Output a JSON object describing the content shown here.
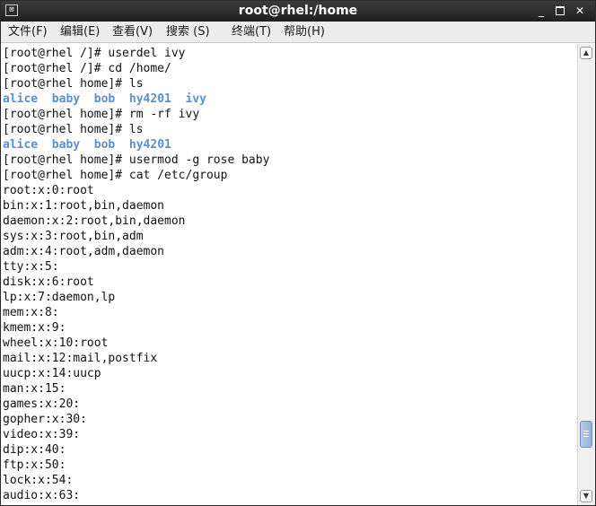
{
  "window": {
    "title": "root@rhel:/home",
    "app_icon_glyph": "⊠",
    "minimize_glyph": "_",
    "close_glyph": "✕"
  },
  "menubar": {
    "items": [
      {
        "label": "文件(F)"
      },
      {
        "label": "编辑(E)"
      },
      {
        "label": "查看(V)"
      },
      {
        "label": "搜索 (S)"
      },
      {
        "label": "终端(T)"
      },
      {
        "label": "帮助(H)"
      }
    ]
  },
  "terminal": {
    "lines": [
      "[root@rhel /]# userdel ivy",
      "[root@rhel /]# cd /home/",
      "[root@rhel home]# ls",
      "",
      "[root@rhel home]# rm -rf ivy",
      "[root@rhel home]# ls",
      "",
      "[root@rhel home]# usermod -g rose baby",
      "[root@rhel home]# cat /etc/group",
      "root:x:0:root",
      "bin:x:1:root,bin,daemon",
      "daemon:x:2:root,bin,daemon",
      "sys:x:3:root,bin,adm",
      "adm:x:4:root,adm,daemon",
      "tty:x:5:",
      "disk:x:6:root",
      "lp:x:7:daemon,lp",
      "mem:x:8:",
      "kmem:x:9:",
      "wheel:x:10:root",
      "mail:x:12:mail,postfix",
      "uucp:x:14:uucp",
      "man:x:15:",
      "games:x:20:",
      "gopher:x:30:",
      "video:x:39:",
      "dip:x:40:",
      "ftp:x:50:",
      "lock:x:54:",
      "audio:x:63:"
    ],
    "ls_output_1": [
      "alice",
      "baby",
      "bob",
      "hy4201",
      "ivy"
    ],
    "ls_output_2": [
      "alice",
      "baby",
      "bob",
      "hy4201"
    ],
    "colors": {
      "directory": "#5b8fcf",
      "text": "#111111",
      "background": "#ffffff"
    }
  },
  "scrollbar": {
    "up_glyph": "▲",
    "down_glyph": "▼"
  }
}
